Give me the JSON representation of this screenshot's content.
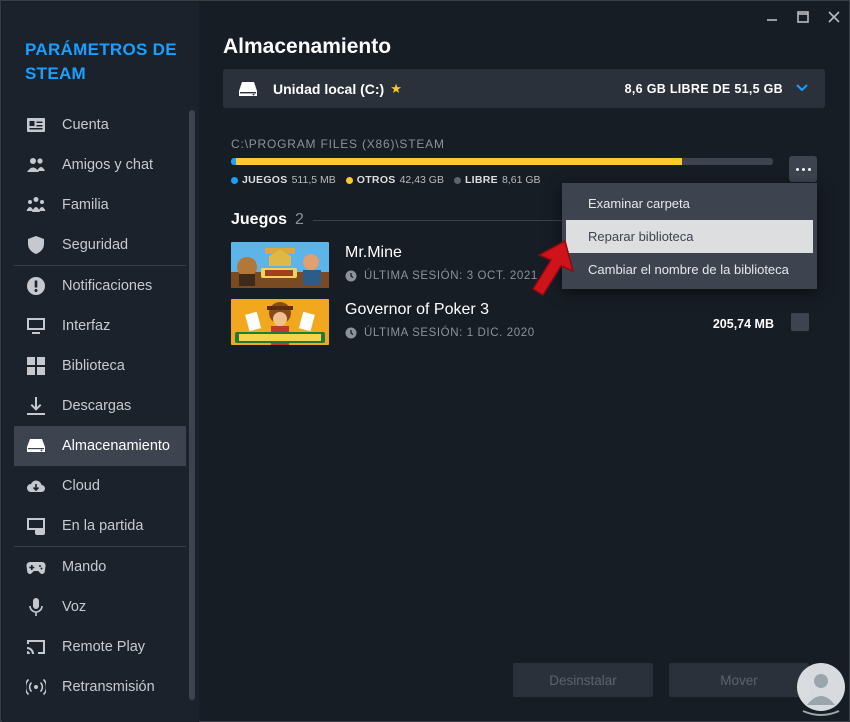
{
  "window": {
    "controls": [
      "minimize",
      "maximize",
      "close"
    ]
  },
  "sidebar": {
    "title": "PARÁMETROS DE STEAM",
    "items": [
      {
        "label": "Cuenta",
        "icon": "id-card-icon",
        "name": "sidebar-item-cuenta"
      },
      {
        "label": "Amigos y chat",
        "icon": "friends-icon",
        "name": "sidebar-item-amigos"
      },
      {
        "label": "Familia",
        "icon": "family-icon",
        "name": "sidebar-item-familia"
      },
      {
        "label": "Seguridad",
        "icon": "shield-icon",
        "name": "sidebar-item-seguridad"
      },
      {
        "label": "Notificaciones",
        "icon": "notification-icon",
        "name": "sidebar-item-notificaciones"
      },
      {
        "label": "Interfaz",
        "icon": "monitor-icon",
        "name": "sidebar-item-interfaz"
      },
      {
        "label": "Biblioteca",
        "icon": "library-grid-icon",
        "name": "sidebar-item-biblioteca"
      },
      {
        "label": "Descargas",
        "icon": "download-icon",
        "name": "sidebar-item-descargas"
      },
      {
        "label": "Almacenamiento",
        "icon": "drive-icon",
        "name": "sidebar-item-almacenamiento",
        "active": true
      },
      {
        "label": "Cloud",
        "icon": "cloud-icon",
        "name": "sidebar-item-cloud"
      },
      {
        "label": "En la partida",
        "icon": "in-game-icon",
        "name": "sidebar-item-en-la-partida"
      },
      {
        "label": "Mando",
        "icon": "gamepad-icon",
        "name": "sidebar-item-mando"
      },
      {
        "label": "Voz",
        "icon": "microphone-icon",
        "name": "sidebar-item-voz"
      },
      {
        "label": "Remote Play",
        "icon": "cast-icon",
        "name": "sidebar-item-remote-play"
      },
      {
        "label": "Retransmisión",
        "icon": "broadcast-icon",
        "name": "sidebar-item-retransmision"
      }
    ]
  },
  "main": {
    "title": "Almacenamiento",
    "drive": {
      "name": "Unidad local (C:)",
      "star": "★",
      "free_text": "8,6 GB LIBRE DE 51,5 GB"
    },
    "path": "C:\\PROGRAM FILES (X86)\\STEAM",
    "usage": {
      "segments": [
        {
          "key": "juegos",
          "label": "JUEGOS",
          "value_text": "511,5 MB",
          "fraction": 0.01,
          "color": "#1a9fff"
        },
        {
          "key": "otros",
          "label": "OTROS",
          "value_text": "42,43 GB",
          "fraction": 0.823,
          "color": "#ffc82c"
        },
        {
          "key": "libre",
          "label": "LIBRE",
          "value_text": "8,61 GB",
          "fraction": 0.167,
          "color": "#3d4450"
        }
      ]
    },
    "games_header": {
      "label": "Juegos",
      "count": "2"
    },
    "games": [
      {
        "name": "Mr.Mine",
        "session": "ÚLTIMA SESIÓN: 3 OCT. 2021",
        "size": ""
      },
      {
        "name": "Governor of Poker 3",
        "session": "ÚLTIMA SESIÓN: 1 DIC. 2020",
        "size": "205,74 MB"
      }
    ],
    "context_menu": [
      {
        "label": "Examinar carpeta",
        "highlighted": false
      },
      {
        "label": "Reparar biblioteca",
        "highlighted": true
      },
      {
        "label": "Cambiar el nombre de la biblioteca",
        "highlighted": false
      }
    ],
    "buttons": {
      "uninstall": "Desinstalar",
      "move": "Mover"
    }
  },
  "colors": {
    "accent": "#1a9fff",
    "star": "#ffc82c",
    "arrow": "#d0121b"
  }
}
